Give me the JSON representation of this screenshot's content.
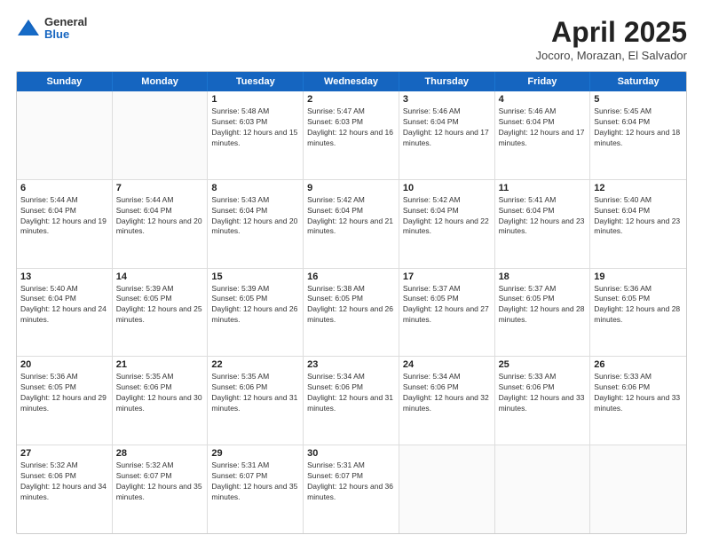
{
  "header": {
    "logo": {
      "general": "General",
      "blue": "Blue"
    },
    "title": "April 2025",
    "subtitle": "Jocoro, Morazan, El Salvador"
  },
  "days_of_week": [
    "Sunday",
    "Monday",
    "Tuesday",
    "Wednesday",
    "Thursday",
    "Friday",
    "Saturday"
  ],
  "weeks": [
    [
      {
        "day": "",
        "empty": true
      },
      {
        "day": "",
        "empty": true
      },
      {
        "day": "1",
        "sunrise": "Sunrise: 5:48 AM",
        "sunset": "Sunset: 6:03 PM",
        "daylight": "Daylight: 12 hours and 15 minutes."
      },
      {
        "day": "2",
        "sunrise": "Sunrise: 5:47 AM",
        "sunset": "Sunset: 6:03 PM",
        "daylight": "Daylight: 12 hours and 16 minutes."
      },
      {
        "day": "3",
        "sunrise": "Sunrise: 5:46 AM",
        "sunset": "Sunset: 6:04 PM",
        "daylight": "Daylight: 12 hours and 17 minutes."
      },
      {
        "day": "4",
        "sunrise": "Sunrise: 5:46 AM",
        "sunset": "Sunset: 6:04 PM",
        "daylight": "Daylight: 12 hours and 17 minutes."
      },
      {
        "day": "5",
        "sunrise": "Sunrise: 5:45 AM",
        "sunset": "Sunset: 6:04 PM",
        "daylight": "Daylight: 12 hours and 18 minutes."
      }
    ],
    [
      {
        "day": "6",
        "sunrise": "Sunrise: 5:44 AM",
        "sunset": "Sunset: 6:04 PM",
        "daylight": "Daylight: 12 hours and 19 minutes."
      },
      {
        "day": "7",
        "sunrise": "Sunrise: 5:44 AM",
        "sunset": "Sunset: 6:04 PM",
        "daylight": "Daylight: 12 hours and 20 minutes."
      },
      {
        "day": "8",
        "sunrise": "Sunrise: 5:43 AM",
        "sunset": "Sunset: 6:04 PM",
        "daylight": "Daylight: 12 hours and 20 minutes."
      },
      {
        "day": "9",
        "sunrise": "Sunrise: 5:42 AM",
        "sunset": "Sunset: 6:04 PM",
        "daylight": "Daylight: 12 hours and 21 minutes."
      },
      {
        "day": "10",
        "sunrise": "Sunrise: 5:42 AM",
        "sunset": "Sunset: 6:04 PM",
        "daylight": "Daylight: 12 hours and 22 minutes."
      },
      {
        "day": "11",
        "sunrise": "Sunrise: 5:41 AM",
        "sunset": "Sunset: 6:04 PM",
        "daylight": "Daylight: 12 hours and 23 minutes."
      },
      {
        "day": "12",
        "sunrise": "Sunrise: 5:40 AM",
        "sunset": "Sunset: 6:04 PM",
        "daylight": "Daylight: 12 hours and 23 minutes."
      }
    ],
    [
      {
        "day": "13",
        "sunrise": "Sunrise: 5:40 AM",
        "sunset": "Sunset: 6:04 PM",
        "daylight": "Daylight: 12 hours and 24 minutes."
      },
      {
        "day": "14",
        "sunrise": "Sunrise: 5:39 AM",
        "sunset": "Sunset: 6:05 PM",
        "daylight": "Daylight: 12 hours and 25 minutes."
      },
      {
        "day": "15",
        "sunrise": "Sunrise: 5:39 AM",
        "sunset": "Sunset: 6:05 PM",
        "daylight": "Daylight: 12 hours and 26 minutes."
      },
      {
        "day": "16",
        "sunrise": "Sunrise: 5:38 AM",
        "sunset": "Sunset: 6:05 PM",
        "daylight": "Daylight: 12 hours and 26 minutes."
      },
      {
        "day": "17",
        "sunrise": "Sunrise: 5:37 AM",
        "sunset": "Sunset: 6:05 PM",
        "daylight": "Daylight: 12 hours and 27 minutes."
      },
      {
        "day": "18",
        "sunrise": "Sunrise: 5:37 AM",
        "sunset": "Sunset: 6:05 PM",
        "daylight": "Daylight: 12 hours and 28 minutes."
      },
      {
        "day": "19",
        "sunrise": "Sunrise: 5:36 AM",
        "sunset": "Sunset: 6:05 PM",
        "daylight": "Daylight: 12 hours and 28 minutes."
      }
    ],
    [
      {
        "day": "20",
        "sunrise": "Sunrise: 5:36 AM",
        "sunset": "Sunset: 6:05 PM",
        "daylight": "Daylight: 12 hours and 29 minutes."
      },
      {
        "day": "21",
        "sunrise": "Sunrise: 5:35 AM",
        "sunset": "Sunset: 6:06 PM",
        "daylight": "Daylight: 12 hours and 30 minutes."
      },
      {
        "day": "22",
        "sunrise": "Sunrise: 5:35 AM",
        "sunset": "Sunset: 6:06 PM",
        "daylight": "Daylight: 12 hours and 31 minutes."
      },
      {
        "day": "23",
        "sunrise": "Sunrise: 5:34 AM",
        "sunset": "Sunset: 6:06 PM",
        "daylight": "Daylight: 12 hours and 31 minutes."
      },
      {
        "day": "24",
        "sunrise": "Sunrise: 5:34 AM",
        "sunset": "Sunset: 6:06 PM",
        "daylight": "Daylight: 12 hours and 32 minutes."
      },
      {
        "day": "25",
        "sunrise": "Sunrise: 5:33 AM",
        "sunset": "Sunset: 6:06 PM",
        "daylight": "Daylight: 12 hours and 33 minutes."
      },
      {
        "day": "26",
        "sunrise": "Sunrise: 5:33 AM",
        "sunset": "Sunset: 6:06 PM",
        "daylight": "Daylight: 12 hours and 33 minutes."
      }
    ],
    [
      {
        "day": "27",
        "sunrise": "Sunrise: 5:32 AM",
        "sunset": "Sunset: 6:06 PM",
        "daylight": "Daylight: 12 hours and 34 minutes."
      },
      {
        "day": "28",
        "sunrise": "Sunrise: 5:32 AM",
        "sunset": "Sunset: 6:07 PM",
        "daylight": "Daylight: 12 hours and 35 minutes."
      },
      {
        "day": "29",
        "sunrise": "Sunrise: 5:31 AM",
        "sunset": "Sunset: 6:07 PM",
        "daylight": "Daylight: 12 hours and 35 minutes."
      },
      {
        "day": "30",
        "sunrise": "Sunrise: 5:31 AM",
        "sunset": "Sunset: 6:07 PM",
        "daylight": "Daylight: 12 hours and 36 minutes."
      },
      {
        "day": "",
        "empty": true
      },
      {
        "day": "",
        "empty": true
      },
      {
        "day": "",
        "empty": true
      }
    ]
  ]
}
